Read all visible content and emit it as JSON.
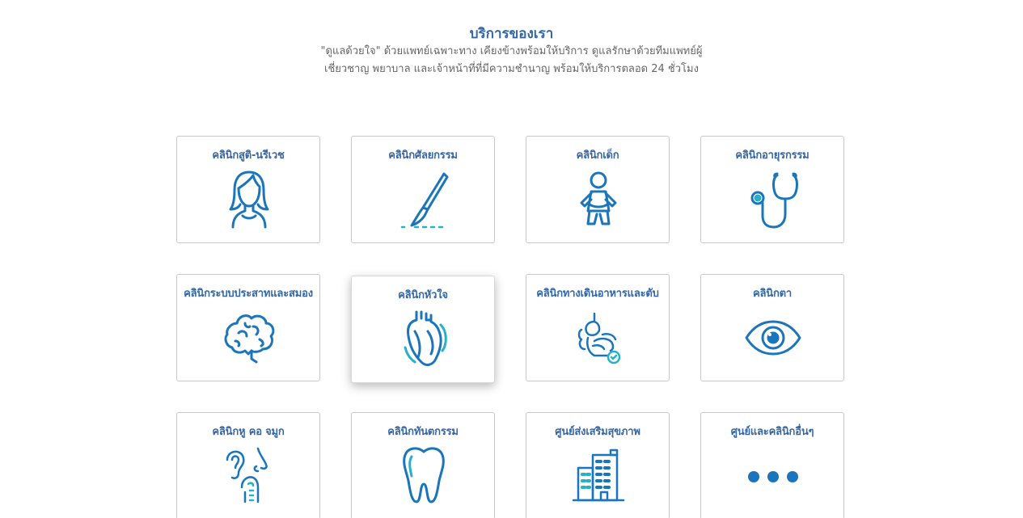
{
  "section": {
    "title": "บริการของเรา",
    "description_line1": "\"ดูแลด้วยใจ\" ด้วยแพทย์เฉพาะทาง เคียงข้างพร้อมให้บริการ ดูแลรักษาด้วยทีมแพทย์ผู้",
    "description_line2": "เชี่ยวชาญ พยาบาล และเจ้าหน้าที่ที่มีความชำนาญ พร้อมให้บริการตลอด 24 ชั่วโมง"
  },
  "clinics": [
    {
      "label": "คลินิกสูติ-นรีเวช",
      "icon": "woman-icon"
    },
    {
      "label": "คลินิกศัลยกรรม",
      "icon": "scalpel-icon"
    },
    {
      "label": "คลินิกเด็ก",
      "icon": "baby-icon"
    },
    {
      "label": "คลินิกอายุรกรรม",
      "icon": "stethoscope-icon"
    },
    {
      "label": "คลินิกระบบประสาทและสมอง",
      "icon": "brain-icon"
    },
    {
      "label": "คลินิกหัวใจ",
      "icon": "heart-icon"
    },
    {
      "label": "คลินิกทางเดินอาหารและตับ",
      "icon": "digestive-system-icon"
    },
    {
      "label": "คลินิกตา",
      "icon": "eye-icon"
    },
    {
      "label": "คลินิกหู คอ จมูก",
      "icon": "ear-nose-throat-icon"
    },
    {
      "label": "คลินิกทันตกรรม",
      "icon": "tooth-icon"
    },
    {
      "label": "ศูนย์ส่งเสริมสุขภาพ",
      "icon": "building-icon"
    },
    {
      "label": "ศูนย์และคลินิกอื่นๆ",
      "icon": "more-dots-icon"
    }
  ],
  "colors": {
    "accent": "#3567a6",
    "icon_blue": "#1a75bb",
    "icon_teal": "#27b1c9",
    "border": "#c9c9c9",
    "text_muted": "#666666"
  }
}
